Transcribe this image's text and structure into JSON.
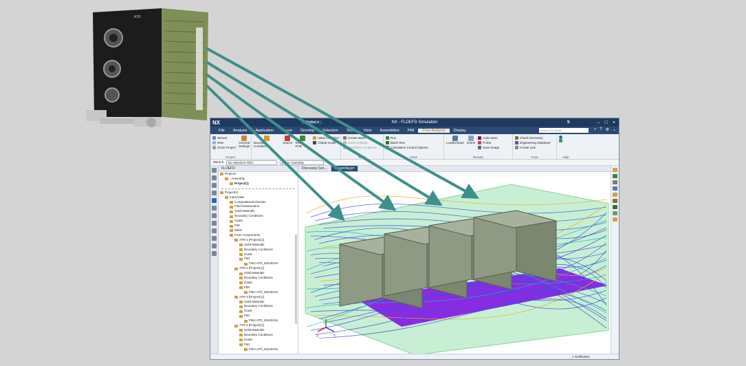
{
  "app": {
    "logo": "NX",
    "title": "NX - FLOEFD Simulation",
    "window_menu": "Window ▾",
    "user": "S",
    "search_placeholder": "Search NX Model"
  },
  "menu": [
    "File",
    "Analysis",
    "Application",
    "Curve",
    "Develop",
    "Selection",
    "Tools",
    "View",
    "Assemblies",
    "PMI",
    "Flow Analysis",
    "Display"
  ],
  "menu_active_index": 10,
  "ribbon": {
    "project_items": [
      "Wizard",
      "New",
      "Clone Project"
    ],
    "project_big": [
      "General Settings"
    ],
    "project_label": "Project",
    "bc_big": [
      "Boundary Condition",
      "Source",
      "Smart PCB"
    ],
    "bc_small": [
      "Initial Condition",
      "Global Goals"
    ],
    "mesh_items": [
      "Create Mesh",
      "Mesh Settings",
      "Boundary Conditions"
    ],
    "mesh_label": "Mesh",
    "solve_items": [
      "Run",
      "Batch Run",
      "Calculation Control Options"
    ],
    "solve_label": "Solve",
    "results_big": [
      "Load/Unload",
      "Scene"
    ],
    "results_small": [
      "Color Bars",
      "Probe",
      "Save Image"
    ],
    "results_label": "Results",
    "tools_items": [
      "Check Geometry",
      "Engineering Database",
      "Create Lids"
    ],
    "tools_label": "Tools",
    "help_label": "Help"
  },
  "toolbar2": {
    "menu_label": "Menu ▾",
    "filter": "No Selection Filter",
    "assembly": "Entire Assembly"
  },
  "nav": {
    "header": "FLOEFD",
    "projects": [
      {
        "label": "Projects",
        "indent": 0,
        "bold": false
      },
      {
        "label": "_Assembly",
        "indent": 1,
        "bold": false
      },
      {
        "label": "Project(1)",
        "indent": 2,
        "bold": true
      }
    ],
    "tree": [
      {
        "label": "Project(1)",
        "indent": 0
      },
      {
        "label": "Input Data",
        "indent": 1
      },
      {
        "label": "Computational Domain",
        "indent": 2
      },
      {
        "label": "Fluid Subdomains",
        "indent": 2
      },
      {
        "label": "Solid Materials",
        "indent": 2
      },
      {
        "label": "Boundary Conditions",
        "indent": 2
      },
      {
        "label": "Goals",
        "indent": 2
      },
      {
        "label": "FMI",
        "indent": 2
      },
      {
        "label": "Mesh",
        "indent": 2
      },
      {
        "label": "From Components",
        "indent": 2
      },
      {
        "label": "ATR-1 [Project(1)]",
        "indent": 3
      },
      {
        "label": "Solid Materials",
        "indent": 4
      },
      {
        "label": "Boundary Conditions",
        "indent": 4
      },
      {
        "label": "Goals",
        "indent": 4
      },
      {
        "label": "FMI",
        "indent": 4
      },
      {
        "label": "FMU ATR_20240215",
        "indent": 5
      },
      {
        "label": "ATR-2 [Project(1)]",
        "indent": 3
      },
      {
        "label": "Solid Materials",
        "indent": 4
      },
      {
        "label": "Boundary Conditions",
        "indent": 4
      },
      {
        "label": "Goals",
        "indent": 4
      },
      {
        "label": "FMI",
        "indent": 4
      },
      {
        "label": "FMU ATR_20240215",
        "indent": 5
      },
      {
        "label": "ATR-3 [Project(1)]",
        "indent": 3
      },
      {
        "label": "Solid Materials",
        "indent": 4
      },
      {
        "label": "Boundary Conditions",
        "indent": 4
      },
      {
        "label": "Goals",
        "indent": 4
      },
      {
        "label": "FMI",
        "indent": 4
      },
      {
        "label": "FMU ATR_20240215",
        "indent": 5
      },
      {
        "label": "ATR-4 [Project(1)]",
        "indent": 3
      },
      {
        "label": "Solid Materials",
        "indent": 4
      },
      {
        "label": "Boundary Conditions",
        "indent": 4
      },
      {
        "label": "Goals",
        "indent": 4
      },
      {
        "label": "FMI",
        "indent": 4
      },
      {
        "label": "FMU ATR_20240215",
        "indent": 5
      }
    ]
  },
  "tabs": [
    "Discovery Cen...",
    "Assembly.prt"
  ],
  "active_tab": 1,
  "status": "1 Notification",
  "colors": {
    "titlebar": "#1f3a5f",
    "menubar": "#2b4a73",
    "arrow": "#3f8f8a",
    "domain_fill": "#c8efd4",
    "module_fill": "#8e9a84",
    "plate_fill": "#8a2be2",
    "streamline": "#3a4fd8"
  }
}
